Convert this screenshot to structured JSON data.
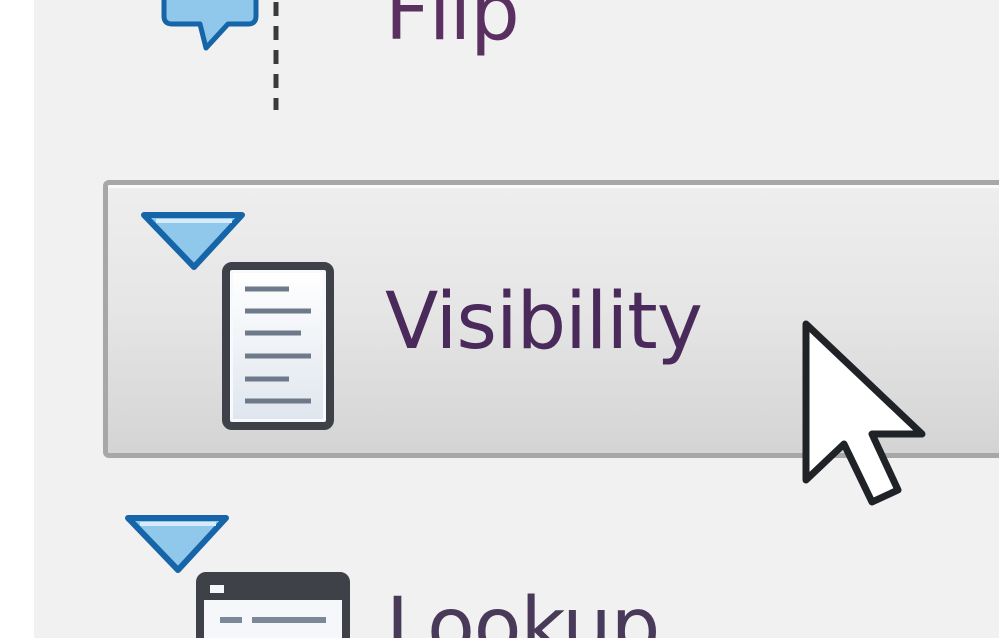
{
  "toolbar": {
    "items": [
      {
        "label": "Flip",
        "icon": "speech-bubble-dropdown-icon"
      },
      {
        "label": "Visibility",
        "icon": "document-lines-icon",
        "state": "hovered"
      },
      {
        "label": "Lookup",
        "icon": "window-table-icon"
      }
    ]
  },
  "colors": {
    "dropdown_fill": "#8fc8ea",
    "dropdown_stroke": "#1565a8",
    "button_border": "#a7a7a7",
    "text": "#4a2a5a"
  }
}
